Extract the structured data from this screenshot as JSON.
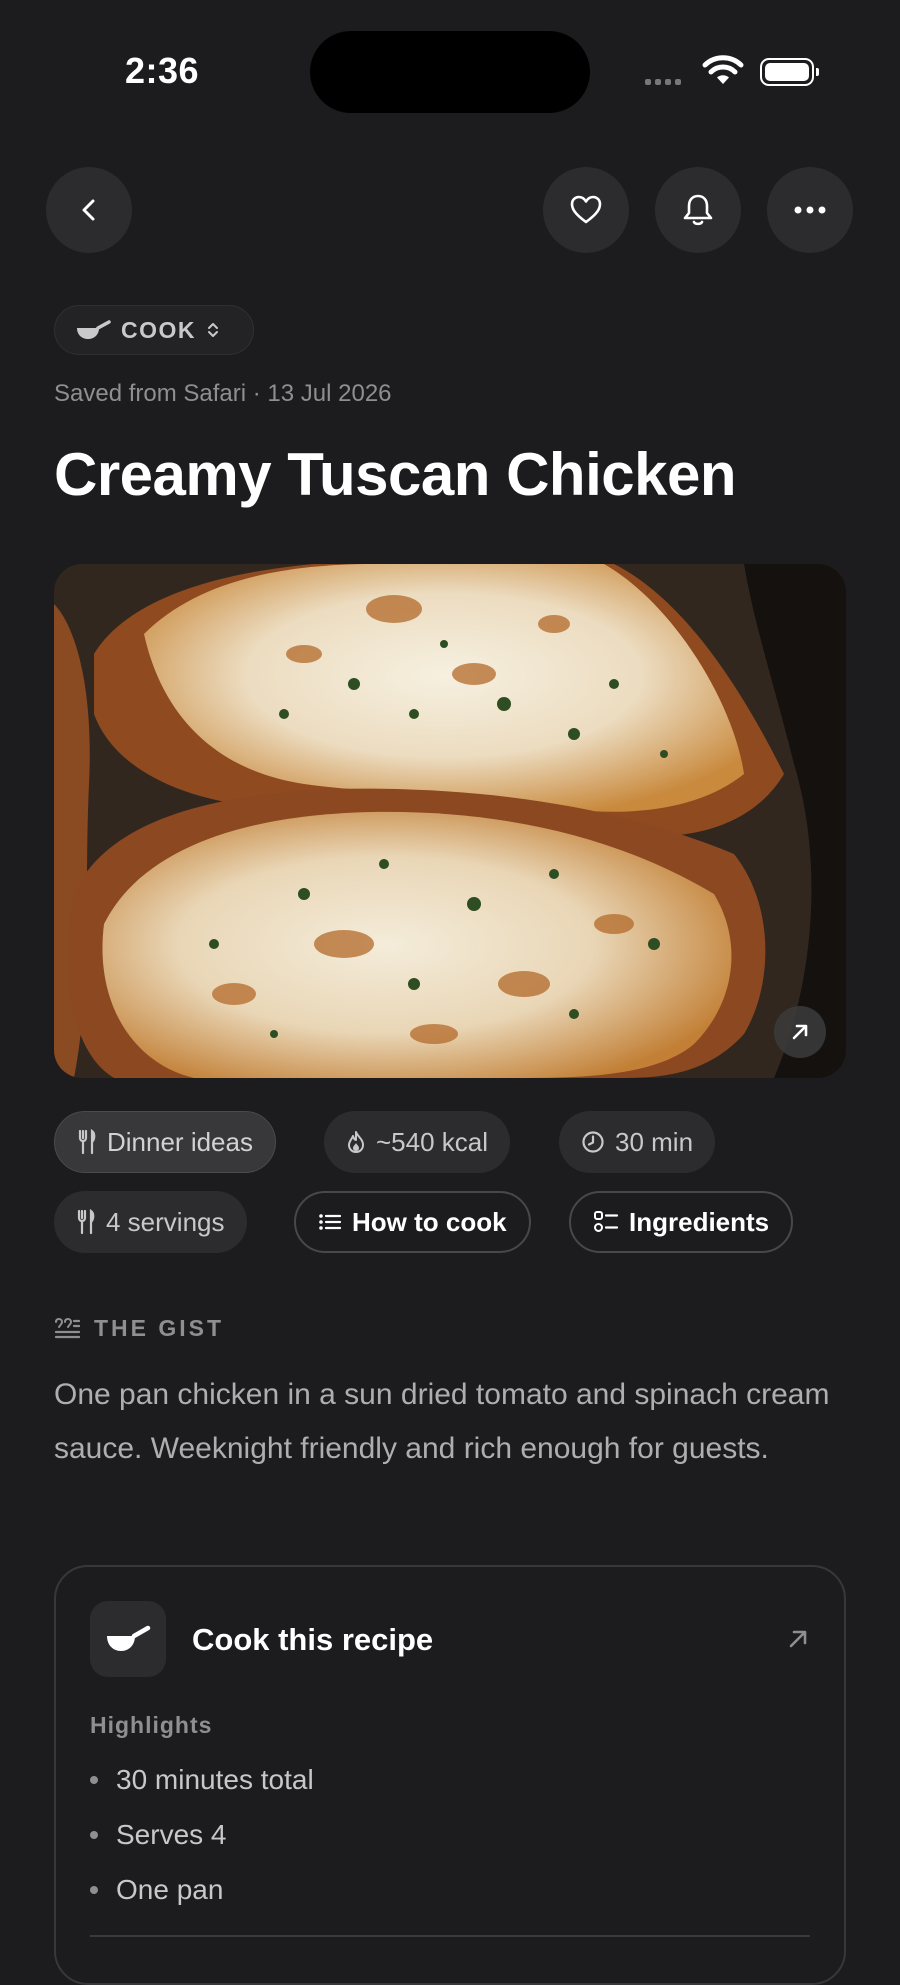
{
  "status": {
    "time": "2:36"
  },
  "category": {
    "label": "COOK"
  },
  "saved_line": "Saved from Safari · 13 Jul 2026",
  "title": "Creamy Tuscan Chicken",
  "chips": {
    "collection": "Dinner ideas",
    "calories": "~540 kcal",
    "time": "30 min",
    "servings": "4 servings",
    "how_to_cook": "How to cook",
    "ingredients": "Ingredients"
  },
  "gist": {
    "heading": "THE GIST",
    "body": "One pan chicken in a sun dried tomato and spinach cream sauce. Weeknight friendly and rich enough for guests."
  },
  "card": {
    "title": "Cook this recipe",
    "highlights_label": "Highlights",
    "highlights": [
      "30 minutes total",
      "Serves 4",
      "One pan"
    ]
  },
  "icons": [
    "back-icon",
    "heart-icon",
    "bell-icon",
    "more-icon",
    "pan-icon",
    "chevron-updown-icon",
    "expand-icon",
    "fork-knife-icon",
    "flame-icon",
    "clock-icon",
    "list-icon",
    "checklist-icon",
    "quote-icon",
    "arrow-up-right-icon"
  ]
}
